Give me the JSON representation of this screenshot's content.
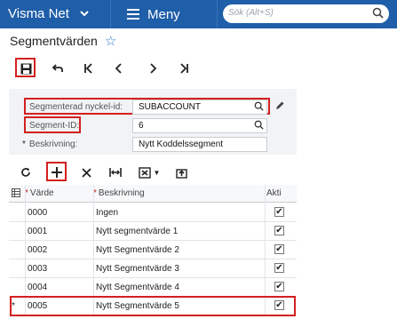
{
  "header": {
    "app_name": "Visma Net",
    "menu_label": "Meny",
    "search_placeholder": "Sök (Alt+S)"
  },
  "page": {
    "title": "Segmentvärden"
  },
  "form": {
    "segmented_key_label": "Segmenterad nyckel-id:",
    "segmented_key_value": "SUBACCOUNT",
    "segment_id_label": "Segment-ID:",
    "segment_id_value": "6",
    "description_label": "Beskrivning:",
    "description_value": "Nytt Koddelssegment"
  },
  "grid": {
    "columns": [
      "Värde",
      "Beskrivning",
      "Akti"
    ],
    "rows": [
      {
        "value": "0000",
        "description": "Ingen",
        "active": "✔"
      },
      {
        "value": "0001",
        "description": "Nytt segmentvärde 1",
        "active": "✔"
      },
      {
        "value": "0002",
        "description": "Nytt Segmentvärde 2",
        "active": "✔"
      },
      {
        "value": "0003",
        "description": "Nytt Segmentvärde 3",
        "active": "✔"
      },
      {
        "value": "0004",
        "description": "Nytt Segmentvärde 4",
        "active": "✔"
      },
      {
        "value": "0005",
        "description": "Nytt Segmentvärde 5",
        "active": "✔"
      }
    ],
    "new_row_marker": "*"
  },
  "colors": {
    "topbar": "#1f5ea8",
    "highlight": "#d32020",
    "accent": "#2b72c4"
  }
}
